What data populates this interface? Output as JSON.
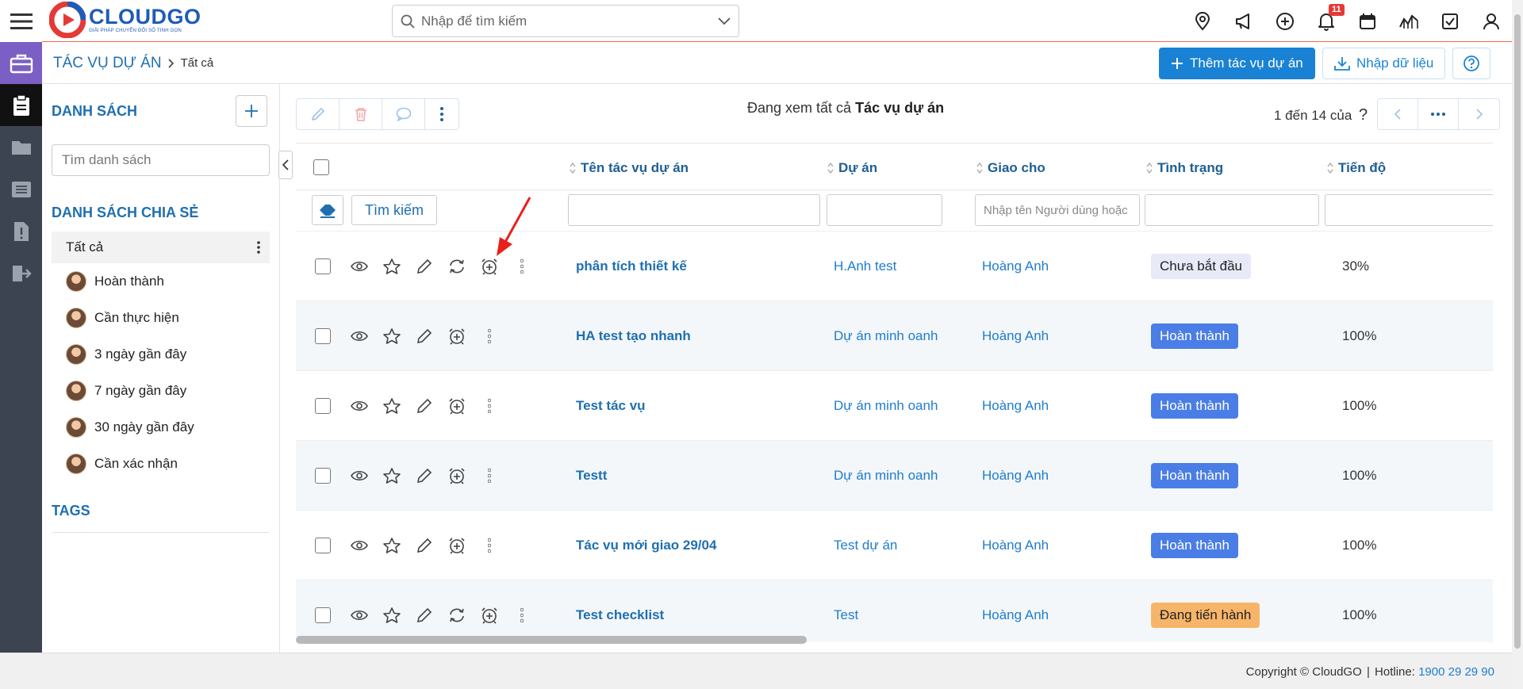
{
  "brand": {
    "name": "CLOUDGO",
    "tagline": "GIẢI PHÁP CHUYỂN ĐỔI SỐ TINH GỌN"
  },
  "search": {
    "placeholder": "Nhập để tìm kiếm"
  },
  "topbar": {
    "notification_count": "11"
  },
  "breadcrumb": {
    "module": "TÁC VỤ DỰ ÁN",
    "current": "Tất cả"
  },
  "header_actions": {
    "add_label": "Thêm tác vụ dự án",
    "import_label": "Nhập dữ liệu"
  },
  "list_panel": {
    "title": "DANH SÁCH",
    "search_placeholder": "Tìm danh sách",
    "shared_title": "DANH SÁCH CHIA SẺ",
    "items": [
      "Tất cả",
      "Hoàn thành",
      "Cần thực hiện",
      "3 ngày gần đây",
      "7 ngày gần đây",
      "30 ngày gần đây",
      "Cần xác nhận"
    ],
    "tags_title": "TAGS"
  },
  "view": {
    "prefix": "Đang xem tất cả",
    "module": "Tác vụ dự án"
  },
  "pager": {
    "text": "1 đến 14 của",
    "more": "?"
  },
  "table": {
    "columns": [
      "Tên tác vụ dự án",
      "Dự án",
      "Giao cho",
      "Tình trạng",
      "Tiến độ"
    ],
    "search_button": "Tìm kiếm",
    "assignee_filter_placeholder": "Nhập tên Người dùng hoặc Nhóm",
    "rows": [
      {
        "name": "phân tích thiết kế",
        "project": "H.Anh test",
        "assignee": "Hoàng Anh",
        "status": "Chưa bắt đầu",
        "progress": "30%"
      },
      {
        "name": "HA test tạo nhanh",
        "project": "Dự án minh oanh",
        "assignee": "Hoàng Anh",
        "status": "Hoàn thành",
        "progress": "100%"
      },
      {
        "name": "Test tác vụ",
        "project": "Dự án minh oanh",
        "assignee": "Hoàng Anh",
        "status": "Hoàn thành",
        "progress": "100%"
      },
      {
        "name": "Testt",
        "project": "Dự án minh oanh",
        "assignee": "Hoàng Anh",
        "status": "Hoàn thành",
        "progress": "100%"
      },
      {
        "name": "Tác vụ mới giao 29/04",
        "project": "Test dự án",
        "assignee": "Hoàng Anh",
        "status": "Hoàn thành",
        "progress": "100%"
      },
      {
        "name": "Test checklist",
        "project": "Test",
        "assignee": "Hoàng Anh",
        "status": "Đang tiến hành",
        "progress": "100%"
      }
    ]
  },
  "footer": {
    "copyright": "Copyright © CloudGO",
    "hotline_label": "Hotline:",
    "hotline": "1900 29 29 90"
  },
  "colors": {
    "primary": "#1a82d4",
    "accent_line": "#f26a4f",
    "rail": "#3c4451",
    "status_done": "#4a7de6",
    "status_progress": "#f7b56a",
    "status_new": "#e8eaf8"
  }
}
